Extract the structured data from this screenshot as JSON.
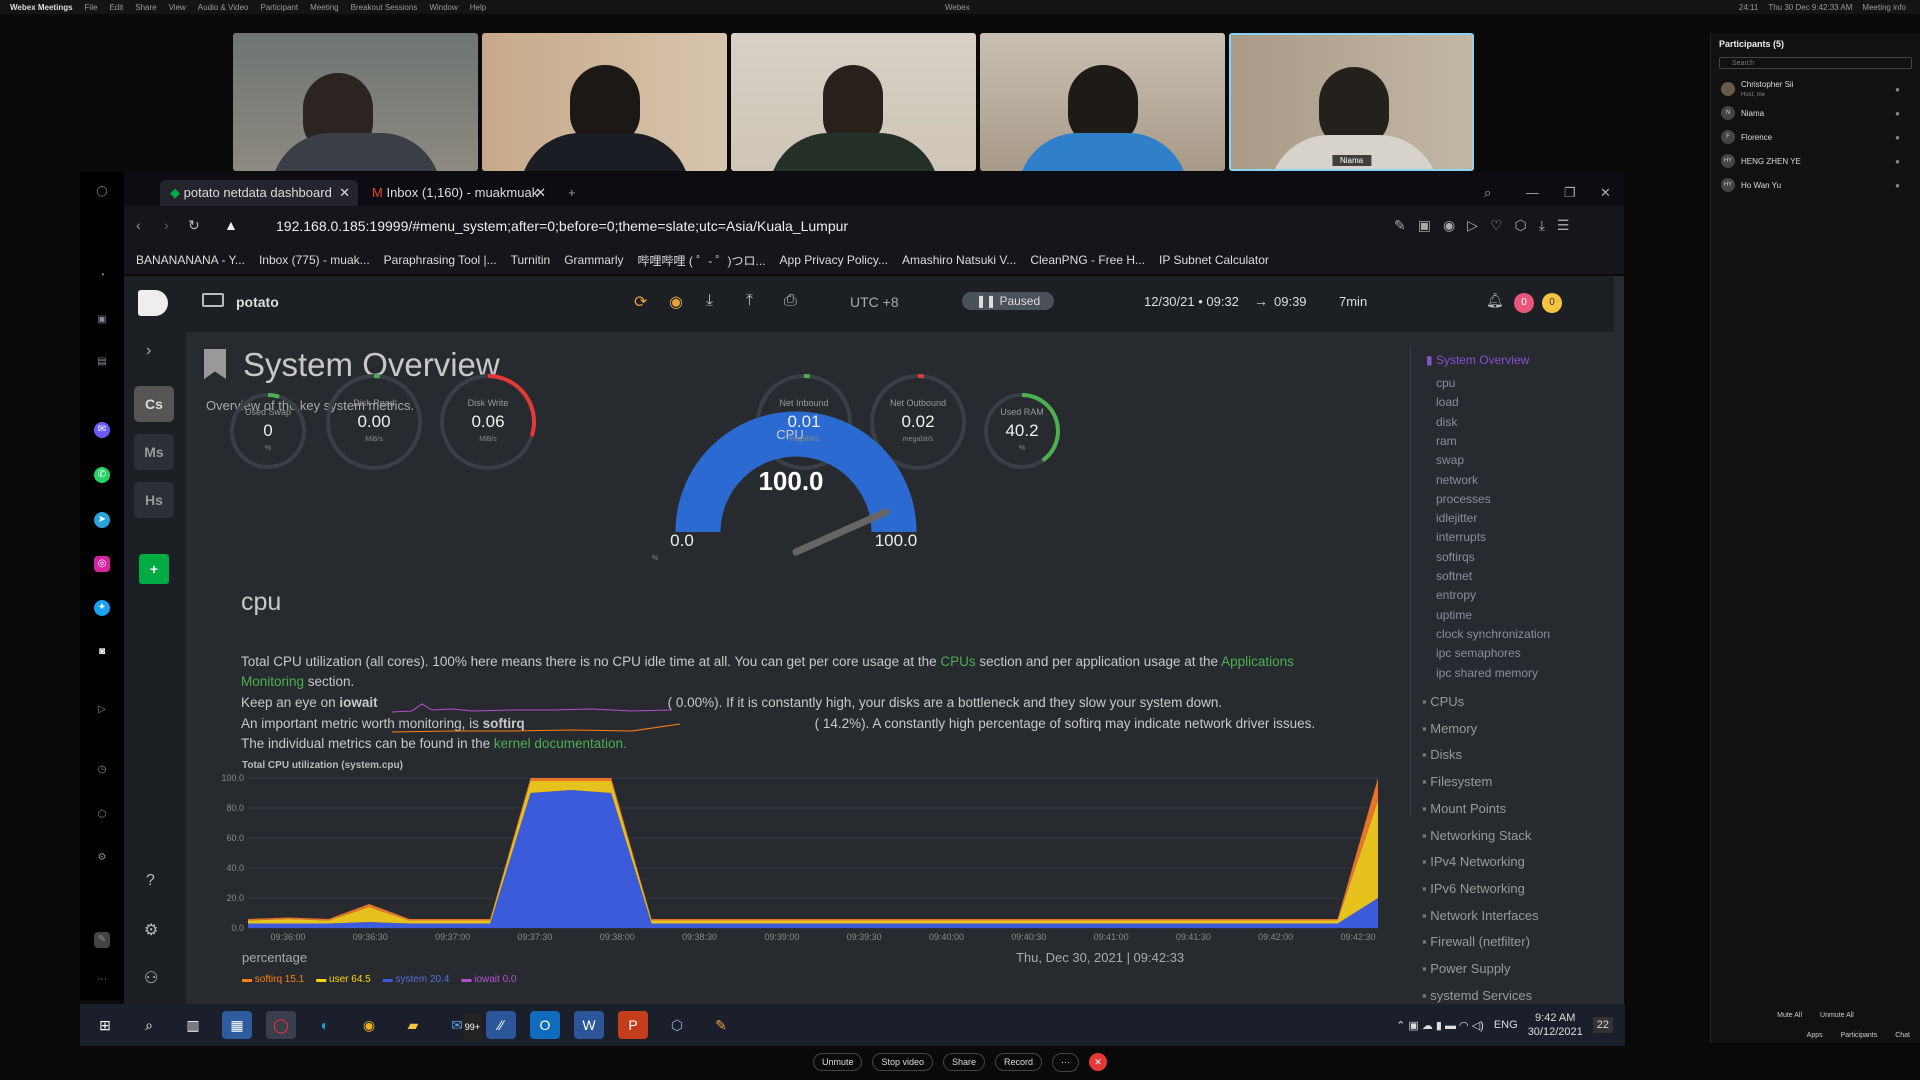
{
  "menubar": {
    "app": "Webex Meetings",
    "items": [
      "File",
      "Edit",
      "Share",
      "View",
      "Audio & Video",
      "Participant",
      "Meeting",
      "Breakout Sessions",
      "Window",
      "Help"
    ],
    "center": "Webex",
    "right": "Thu 30 Dec  9:42:33 AM",
    "meeting_info": "Meeting info",
    "time_short": "24:11"
  },
  "tiles": [
    {
      "name": ""
    },
    {
      "name": ""
    },
    {
      "name": ""
    },
    {
      "name": ""
    },
    {
      "name": "Niama"
    }
  ],
  "participants": {
    "title": "Participants (5)",
    "search_placeholder": "Search",
    "people": [
      {
        "initials": "",
        "name": "Christopher Sii",
        "sub": "Host, me"
      },
      {
        "initials": "N",
        "name": "Niama",
        "sub": ""
      },
      {
        "initials": "F",
        "name": "Florence",
        "sub": ""
      },
      {
        "initials": "HY",
        "name": "HENG ZHEN YE",
        "sub": ""
      },
      {
        "initials": "HY",
        "name": "Ho Wan Yu",
        "sub": ""
      }
    ],
    "mute_all": "Mute All",
    "unmute_all": "Unmute All",
    "bottom": [
      "Apps",
      "Participants",
      "Chat"
    ]
  },
  "browser": {
    "tabs": [
      {
        "label": "potato netdata dashboard"
      },
      {
        "label": "Inbox (1,160) - muakmuak"
      }
    ],
    "url": "192.168.0.185:19999/#menu_system;after=0;before=0;theme=slate;utc=Asia/Kuala_Lumpur",
    "bookmarks": [
      "BANANANANA - Y...",
      "Inbox (775) - muak...",
      "Paraphrasing Tool |...",
      "Turnitin",
      "Grammarly",
      "哔哩哔哩 ( ゜- ゜)つロ...",
      "App Privacy Policy...",
      "Amashiro Natsuki V...",
      "CleanPNG - Free H...",
      "IP Subnet Calculator"
    ]
  },
  "netdata": {
    "host": "potato",
    "timezone": "UTC +8",
    "paused": "Paused",
    "range_from": "12/30/21 • 09:32",
    "range_to": "09:39",
    "duration": "7min",
    "badge_red": "0",
    "badge_yellow": "0",
    "side_buttons": [
      "Cs",
      "Ms",
      "Hs"
    ],
    "title": "System Overview",
    "subtitle": "Overview of the key system metrics.",
    "gauges": [
      {
        "title": "Used Swap",
        "value": "0",
        "unit": "%"
      },
      {
        "title": "Disk Read",
        "value": "0.00",
        "unit": "MiB/s"
      },
      {
        "title": "Disk Write",
        "value": "0.06",
        "unit": "MiB/s"
      },
      {
        "title": "Net Inbound",
        "value": "0.01",
        "unit": "megabit/s"
      },
      {
        "title": "Net Outbound",
        "value": "0.02",
        "unit": "megabit/s"
      },
      {
        "title": "Used RAM",
        "value": "40.2",
        "unit": "%"
      }
    ],
    "cpu_gauge": {
      "label": "CPU",
      "value": "100.0",
      "min": "0.0",
      "max": "100.0",
      "unit": "%",
      "level": 1.0
    },
    "section": "cpu",
    "para1a": "Total CPU utilization (all cores). 100% here means there is no CPU idle time at all. You can get per core usage at the ",
    "cpus_link": "CPUs",
    "para1b": " section and per application usage at the ",
    "apps_link": "Applications",
    "para1c": "Monitoring",
    " para1d": " section.",
    "line2a": "Keep an eye on ",
    "iowait": "iowait",
    "line2b": "(      0.00%). If it is constantly high, your disks are a bottleneck and they slow your system down.",
    "line3a": "An important metric worth monitoring, is ",
    "softirq": "softirq",
    "line3b": "(      14.2%). A constantly high percentage of softirq may indicate network driver issues.",
    "line4a": "The individual metrics can be found in the ",
    "kernel_link": "kernel documentation.",
    "chart_caption": "Total CPU utilization (system.cpu)",
    "chart_unit": "percentage",
    "chart_time": "Thu, Dec 30, 2021 | 09:42:33",
    "legend": [
      {
        "name": "softirq",
        "value": "15.1",
        "color": "#ff7f0e"
      },
      {
        "name": "user",
        "value": "64.5",
        "color": "#ffd700"
      },
      {
        "name": "system",
        "value": "20.4",
        "color": "#3b5bdb"
      },
      {
        "name": "iowait",
        "value": "0.0",
        "color": "#b84fd1"
      }
    ],
    "menu": {
      "head": "System Overview",
      "items": [
        "cpu",
        "load",
        "disk",
        "ram",
        "swap",
        "network",
        "processes",
        "idlejitter",
        "interrupts",
        "softirqs",
        "softnet",
        "entropy",
        "uptime",
        "clock synchronization",
        "ipc semaphores",
        "ipc shared memory"
      ],
      "sections": [
        "CPUs",
        "Memory",
        "Disks",
        "Filesystem",
        "Mount Points",
        "Networking Stack",
        "IPv4 Networking",
        "IPv6 Networking",
        "Network Interfaces",
        "Firewall (netfilter)",
        "Power Supply",
        "systemd Services"
      ]
    }
  },
  "chart_data": {
    "type": "area",
    "title": "Total CPU utilization (system.cpu)",
    "ylabel": "percentage",
    "ylim": [
      0,
      100
    ],
    "yticks": [
      "100.0",
      "80.0",
      "60.0",
      "40.0",
      "20.0",
      "0.0"
    ],
    "xticks": [
      "09:36:00",
      "09:36:30",
      "09:37:00",
      "09:37:30",
      "09:38:00",
      "09:38:30",
      "09:39:00",
      "09:39:30",
      "09:40:00",
      "09:40:30",
      "09:41:00",
      "09:41:30",
      "09:42:00",
      "09:42:30"
    ],
    "series": [
      {
        "name": "system",
        "values": [
          3,
          3,
          3,
          4,
          3,
          3,
          3,
          90,
          92,
          90,
          3,
          3,
          3,
          3,
          3,
          3,
          3,
          3,
          3,
          3,
          3,
          3,
          3,
          3,
          3,
          3,
          3,
          3,
          20
        ]
      },
      {
        "name": "user",
        "values": [
          2,
          3,
          2,
          10,
          2,
          2,
          2,
          8,
          6,
          8,
          2,
          2,
          2,
          2,
          2,
          2,
          2,
          2,
          2,
          2,
          2,
          2,
          2,
          2,
          2,
          2,
          2,
          2,
          65
        ]
      },
      {
        "name": "softirq",
        "values": [
          1,
          1,
          1,
          2,
          1,
          1,
          1,
          2,
          2,
          2,
          1,
          1,
          1,
          1,
          1,
          1,
          1,
          1,
          1,
          1,
          1,
          1,
          1,
          1,
          1,
          1,
          1,
          1,
          15
        ]
      }
    ]
  },
  "taskbar": {
    "badge": "99+",
    "lang": "ENG",
    "time": "9:42 AM",
    "date": "30/12/2021",
    "notif": "22"
  },
  "zoombar": {
    "buttons": [
      "Unmute",
      "Stop video",
      "Share",
      "Record"
    ]
  }
}
